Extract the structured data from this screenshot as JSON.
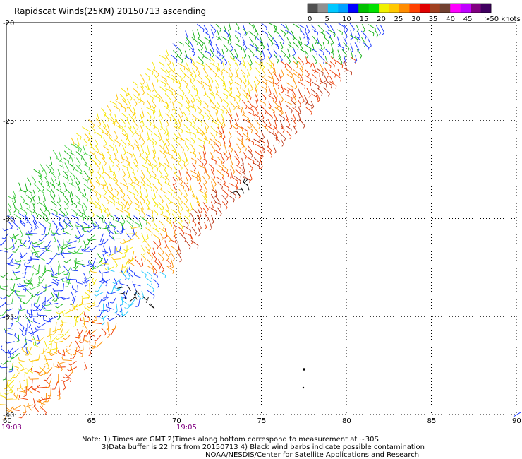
{
  "title": "Rapidscat Winds(25KM) 20150713 ascending",
  "axes": {
    "lon_ticks": [
      "60",
      "65",
      "70",
      "75",
      "80",
      "85",
      "90"
    ],
    "lat_ticks": [
      "-20",
      "-25",
      "-30",
      "-35",
      "-40"
    ],
    "lon_range": [
      60,
      90
    ],
    "lat_range": [
      -20,
      -40
    ],
    "grid": true
  },
  "colorbar": {
    "tick_labels": [
      "0",
      "5",
      "10",
      "15",
      "20",
      "25",
      "30",
      "35",
      "40",
      "45"
    ],
    "unit_label": ">50 knots",
    "colors": [
      "#505050",
      "#909090",
      "#00c8ff",
      "#00a0ff",
      "#0000ff",
      "#00c000",
      "#00e000",
      "#f0f000",
      "#ffc800",
      "#ff8c00",
      "#ff4000",
      "#e00000",
      "#a04020",
      "#704030",
      "#ff00ff",
      "#c000ff",
      "#800080",
      "#400060"
    ]
  },
  "times": {
    "left": "19:03",
    "middle": "19:05"
  },
  "notes": {
    "line1": "Note: 1) Times are GMT 2)Times along bottom correspond to measurement at ~30S",
    "line2": "3)Data buffer is 22 hrs from 20150713 4) Black wind barbs indicate possible contamination",
    "line3": "NOAA/NESDIS/Center for Satellite Applications and Research"
  }
}
